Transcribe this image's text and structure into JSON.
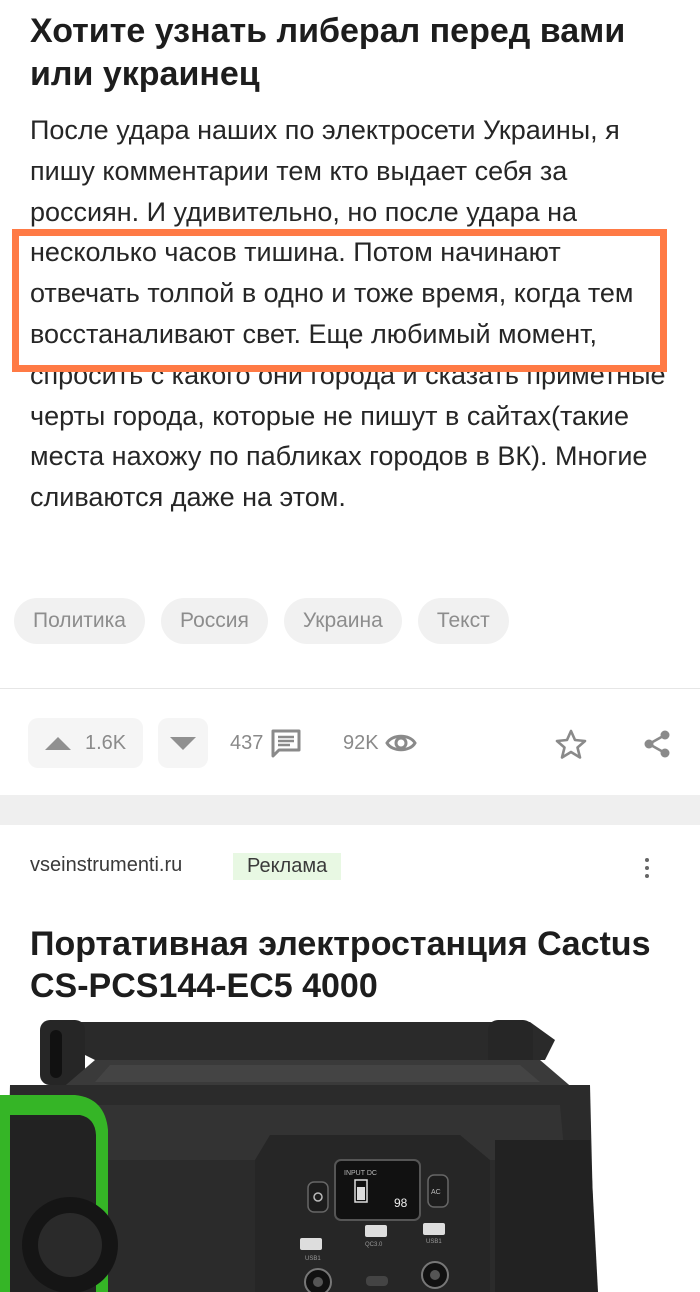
{
  "post": {
    "title": "Хотите узнать либерал перед вами или украинец",
    "body": "После удара наших по электросети Украины, я пишу комментарии тем кто выдает себя за россиян. И удивительно, но после удара на несколько часов тишина. Потом начинают отвечать толпой в одно и тоже время, когда тем восстаналивают свет. Еще любимый момент, спросить с какого они города и сказать приметные черты города, которые не пишут в сайтах(такие места нахожу по пабликах городов в ВК). Многие сливаются даже на этом.",
    "tags": [
      "Политика",
      "Россия",
      "Украина",
      "Текст"
    ],
    "highlight_color": "#ff7a45"
  },
  "actions": {
    "rating": "1.6K",
    "comments": "437",
    "views": "92K",
    "icons": [
      "arrow-up-icon",
      "arrow-down-icon",
      "comment-icon",
      "eye-icon",
      "star-icon",
      "share-icon"
    ]
  },
  "ad": {
    "source": "vseinstrumenti.ru",
    "badge": "Реклама",
    "badge_color": "#e8f8e3",
    "title": "Портативная электростанция Cactus CS-PCS144-EC5 4000",
    "image": {
      "display_text": "98",
      "screen_label": "INPUT DC",
      "port_labels": [
        "USB1",
        "QC3.0",
        "USB1",
        "DC/12V"
      ],
      "button_labels": [
        "AC"
      ],
      "accent_color": "#35b526"
    }
  }
}
